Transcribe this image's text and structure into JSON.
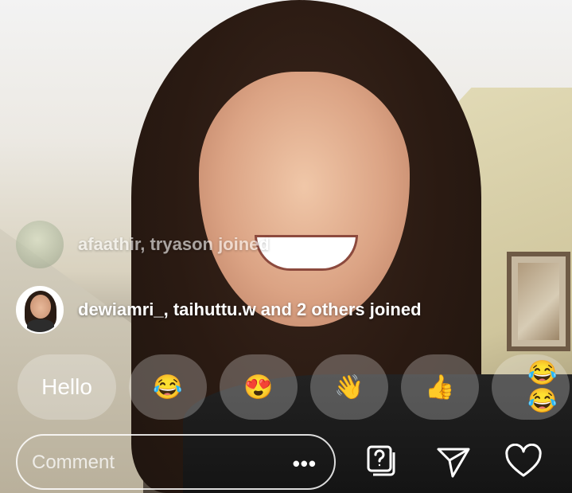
{
  "joins": [
    {
      "text": "afaathir, tryason joined"
    },
    {
      "text": "dewiamri_, taihuttu.w and 2 others joined"
    }
  ],
  "quick_replies": [
    {
      "label": "Hello",
      "type": "text"
    },
    {
      "label": "😂",
      "type": "emoji"
    },
    {
      "label": "😍",
      "type": "emoji"
    },
    {
      "label": "👋",
      "type": "emoji"
    },
    {
      "label": "👍",
      "type": "emoji"
    },
    {
      "label": "😂😂",
      "type": "emoji"
    }
  ],
  "comment": {
    "placeholder": "Comment",
    "more_label": "•••"
  },
  "actions": {
    "question_icon": "question-icon",
    "send_icon": "send-icon",
    "like_icon": "heart-icon"
  }
}
